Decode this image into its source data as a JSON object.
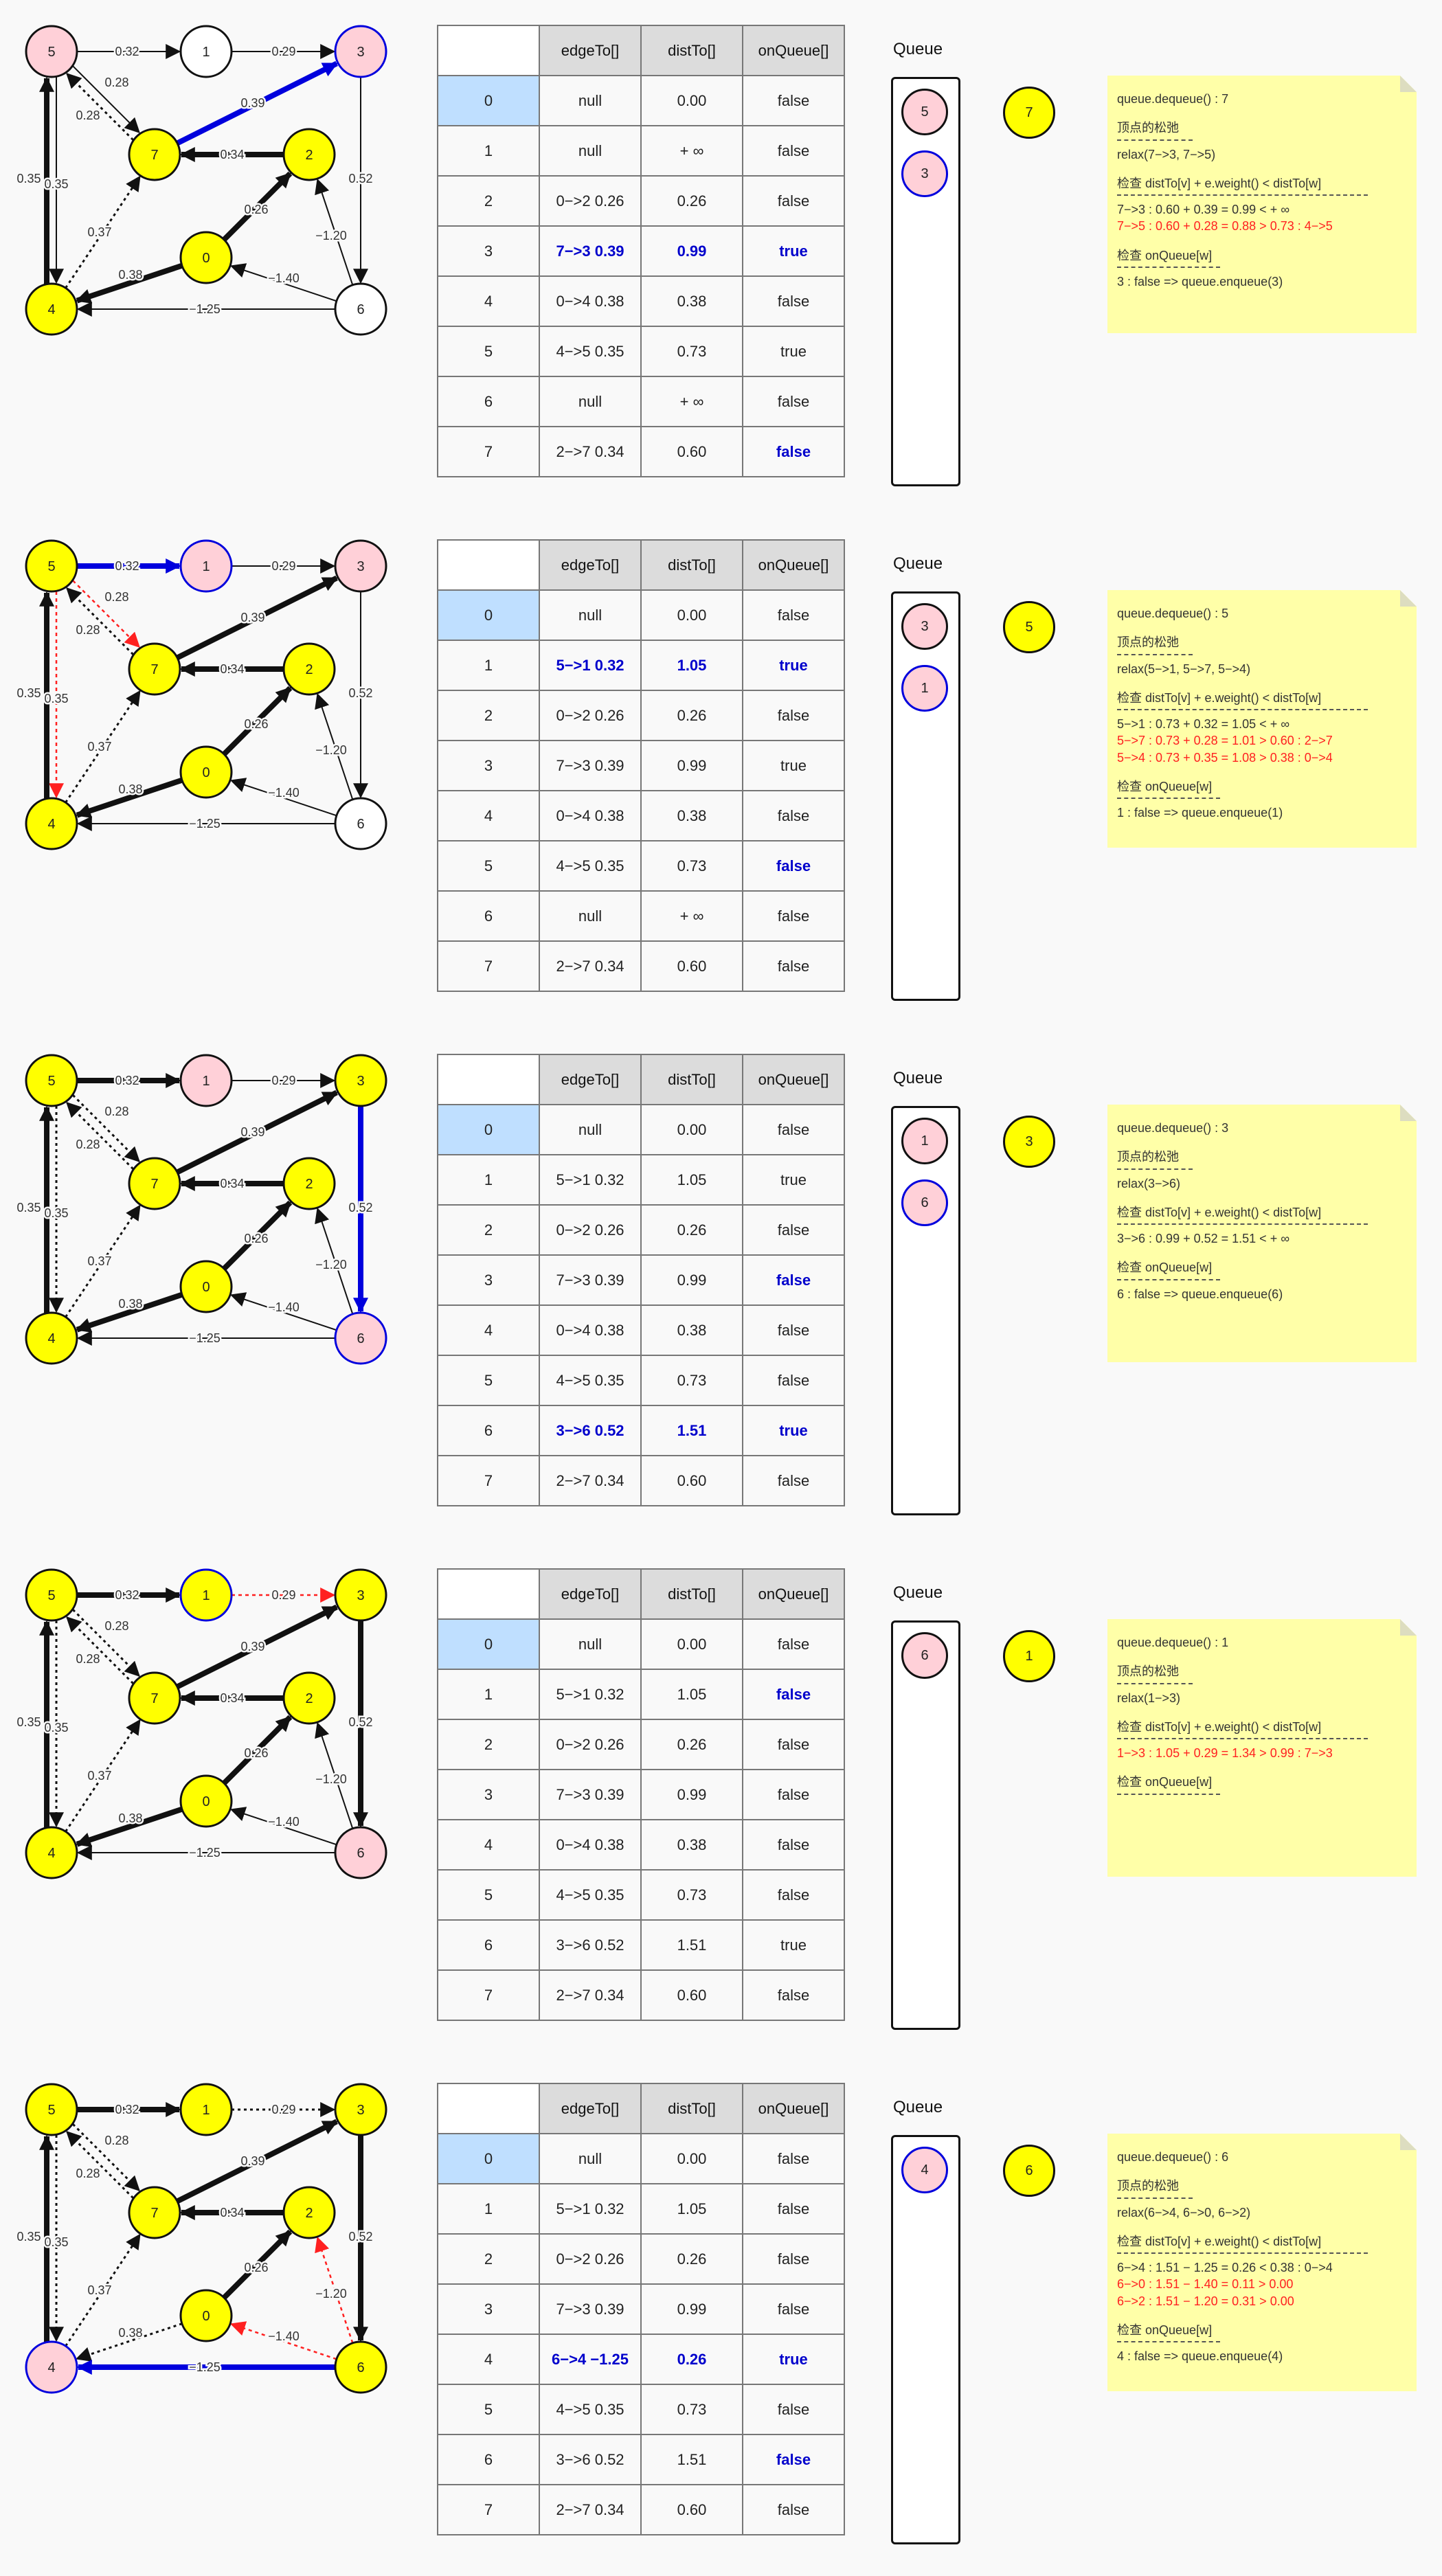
{
  "columns": [
    "edgeTo[]",
    "distTo[]",
    "onQueue[]"
  ],
  "queue_label": "Queue",
  "steps": [
    {
      "current": "7",
      "queue": [
        {
          "v": "5",
          "blue": false
        },
        {
          "v": "3",
          "blue": true
        }
      ],
      "rows": [
        {
          "v": "0",
          "edge": "null",
          "dist": "0.00",
          "onq": "false",
          "hl": []
        },
        {
          "v": "1",
          "edge": "null",
          "dist": "+ ∞",
          "onq": "false",
          "hl": []
        },
        {
          "v": "2",
          "edge": "0−>2 0.26",
          "dist": "0.26",
          "onq": "false",
          "hl": []
        },
        {
          "v": "3",
          "edge": "7−>3 0.39",
          "dist": "0.99",
          "onq": "true",
          "hl": [
            "edge",
            "dist",
            "onq"
          ]
        },
        {
          "v": "4",
          "edge": "0−>4 0.38",
          "dist": "0.38",
          "onq": "false",
          "hl": []
        },
        {
          "v": "5",
          "edge": "4−>5 0.35",
          "dist": "0.73",
          "onq": "true",
          "hl": []
        },
        {
          "v": "6",
          "edge": "null",
          "dist": "+ ∞",
          "onq": "false",
          "hl": []
        },
        {
          "v": "7",
          "edge": "2−>7 0.34",
          "dist": "0.60",
          "onq": "false",
          "hl": [
            "onq"
          ]
        }
      ],
      "nodes": {
        "0": "y",
        "1": "w",
        "2": "y",
        "3": "pb",
        "4": "y",
        "5": "p",
        "6": "w",
        "7": "y"
      },
      "edges": {
        "e53": "red",
        "e57": "thin",
        "e73": "blue"
      },
      "note": {
        "dequeue": "queue.dequeue() : 7",
        "relax_title": "顶点的松弛",
        "relax": "relax(7−>3, 7−>5)",
        "check_title": "检查 distTo[v] + e.weight() < distTo[w]",
        "check": [
          {
            "t": "7−>3 : 0.60 + 0.39 = 0.99 < + ∞",
            "red": false
          },
          {
            "t": "7−>5 : 0.60 + 0.28 = 0.88 > 0.73 : 4−>5",
            "red": true
          }
        ],
        "onq_title": "检查 onQueue[w]",
        "onq": "3 : false => queue.enqueue(3)"
      }
    },
    {
      "current": "5",
      "queue": [
        {
          "v": "3",
          "blue": false
        },
        {
          "v": "1",
          "blue": true
        }
      ],
      "rows": [
        {
          "v": "0",
          "edge": "null",
          "dist": "0.00",
          "onq": "false",
          "hl": []
        },
        {
          "v": "1",
          "edge": "5−>1 0.32",
          "dist": "1.05",
          "onq": "true",
          "hl": [
            "edge",
            "dist",
            "onq"
          ]
        },
        {
          "v": "2",
          "edge": "0−>2 0.26",
          "dist": "0.26",
          "onq": "false",
          "hl": []
        },
        {
          "v": "3",
          "edge": "7−>3 0.39",
          "dist": "0.99",
          "onq": "true",
          "hl": []
        },
        {
          "v": "4",
          "edge": "0−>4 0.38",
          "dist": "0.38",
          "onq": "false",
          "hl": []
        },
        {
          "v": "5",
          "edge": "4−>5 0.35",
          "dist": "0.73",
          "onq": "false",
          "hl": [
            "onq"
          ]
        },
        {
          "v": "6",
          "edge": "null",
          "dist": "+ ∞",
          "onq": "false",
          "hl": []
        },
        {
          "v": "7",
          "edge": "2−>7 0.34",
          "dist": "0.60",
          "onq": "false",
          "hl": []
        }
      ],
      "nodes": {
        "0": "y",
        "1": "pb",
        "2": "y",
        "3": "p",
        "4": "y",
        "5": "y",
        "6": "w",
        "7": "y"
      },
      "edges": {
        "e51": "blue",
        "e57": "red",
        "e54": "red",
        "e73": "bold"
      },
      "note": {
        "dequeue": "queue.dequeue() : 5",
        "relax_title": "顶点的松弛",
        "relax": "relax(5−>1, 5−>7, 5−>4)",
        "check_title": "检查 distTo[v] + e.weight() < distTo[w]",
        "check": [
          {
            "t": "5−>1 : 0.73 + 0.32 = 1.05 < + ∞",
            "red": false
          },
          {
            "t": "5−>7 : 0.73 + 0.28 = 1.01 > 0.60 : 2−>7",
            "red": true
          },
          {
            "t": "5−>4 : 0.73 + 0.35 = 1.08 > 0.38 : 0−>4",
            "red": true
          }
        ],
        "onq_title": "检查 onQueue[w]",
        "onq": "1 : false => queue.enqueue(1)"
      }
    },
    {
      "current": "3",
      "queue": [
        {
          "v": "1",
          "blue": false
        },
        {
          "v": "6",
          "blue": true
        }
      ],
      "rows": [
        {
          "v": "0",
          "edge": "null",
          "dist": "0.00",
          "onq": "false",
          "hl": []
        },
        {
          "v": "1",
          "edge": "5−>1 0.32",
          "dist": "1.05",
          "onq": "true",
          "hl": []
        },
        {
          "v": "2",
          "edge": "0−>2 0.26",
          "dist": "0.26",
          "onq": "false",
          "hl": []
        },
        {
          "v": "3",
          "edge": "7−>3 0.39",
          "dist": "0.99",
          "onq": "false",
          "hl": [
            "onq"
          ]
        },
        {
          "v": "4",
          "edge": "0−>4 0.38",
          "dist": "0.38",
          "onq": "false",
          "hl": []
        },
        {
          "v": "5",
          "edge": "4−>5 0.35",
          "dist": "0.73",
          "onq": "false",
          "hl": []
        },
        {
          "v": "6",
          "edge": "3−>6 0.52",
          "dist": "1.51",
          "onq": "true",
          "hl": [
            "edge",
            "dist",
            "onq"
          ]
        },
        {
          "v": "7",
          "edge": "2−>7 0.34",
          "dist": "0.60",
          "onq": "false",
          "hl": []
        }
      ],
      "nodes": {
        "0": "y",
        "1": "p",
        "2": "y",
        "3": "y",
        "4": "y",
        "5": "y",
        "6": "pb",
        "7": "y"
      },
      "edges": {
        "e51": "bold",
        "e57": "dot",
        "e54": "dot",
        "e73": "bold",
        "e36": "blue"
      },
      "note": {
        "dequeue": "queue.dequeue() : 3",
        "relax_title": "顶点的松弛",
        "relax": "relax(3−>6)",
        "check_title": "检查 distTo[v] + e.weight() < distTo[w]",
        "check": [
          {
            "t": "3−>6 : 0.99 + 0.52 = 1.51 < + ∞",
            "red": false
          }
        ],
        "onq_title": "检查 onQueue[w]",
        "onq": "6 : false => queue.enqueue(6)"
      }
    },
    {
      "current": "1",
      "queue": [
        {
          "v": "6",
          "blue": false
        }
      ],
      "rows": [
        {
          "v": "0",
          "edge": "null",
          "dist": "0.00",
          "onq": "false",
          "hl": []
        },
        {
          "v": "1",
          "edge": "5−>1 0.32",
          "dist": "1.05",
          "onq": "false",
          "hl": [
            "onq"
          ]
        },
        {
          "v": "2",
          "edge": "0−>2 0.26",
          "dist": "0.26",
          "onq": "false",
          "hl": []
        },
        {
          "v": "3",
          "edge": "7−>3 0.39",
          "dist": "0.99",
          "onq": "false",
          "hl": []
        },
        {
          "v": "4",
          "edge": "0−>4 0.38",
          "dist": "0.38",
          "onq": "false",
          "hl": []
        },
        {
          "v": "5",
          "edge": "4−>5 0.35",
          "dist": "0.73",
          "onq": "false",
          "hl": []
        },
        {
          "v": "6",
          "edge": "3−>6 0.52",
          "dist": "1.51",
          "onq": "true",
          "hl": []
        },
        {
          "v": "7",
          "edge": "2−>7 0.34",
          "dist": "0.60",
          "onq": "false",
          "hl": []
        }
      ],
      "nodes": {
        "0": "y",
        "1": "yb",
        "2": "y",
        "3": "y",
        "4": "y",
        "5": "y",
        "6": "p",
        "7": "y"
      },
      "edges": {
        "e51": "bold",
        "e57": "dot",
        "e54": "dot",
        "e73": "bold",
        "e36": "bold",
        "e13": "red"
      },
      "note": {
        "dequeue": "queue.dequeue() : 1",
        "relax_title": "顶点的松弛",
        "relax": "relax(1−>3)",
        "check_title": "检查 distTo[v] + e.weight() < distTo[w]",
        "check": [
          {
            "t": "1−>3 : 1.05 + 0.29 = 1.34 > 0.99 : 7−>3",
            "red": true
          }
        ],
        "onq_title": "检查 onQueue[w]",
        "onq": ""
      }
    },
    {
      "current": "6",
      "queue": [
        {
          "v": "4",
          "blue": true
        }
      ],
      "rows": [
        {
          "v": "0",
          "edge": "null",
          "dist": "0.00",
          "onq": "false",
          "hl": []
        },
        {
          "v": "1",
          "edge": "5−>1 0.32",
          "dist": "1.05",
          "onq": "false",
          "hl": []
        },
        {
          "v": "2",
          "edge": "0−>2 0.26",
          "dist": "0.26",
          "onq": "false",
          "hl": []
        },
        {
          "v": "3",
          "edge": "7−>3 0.39",
          "dist": "0.99",
          "onq": "false",
          "hl": []
        },
        {
          "v": "4",
          "edge": "6−>4 −1.25",
          "dist": "0.26",
          "onq": "true",
          "hl": [
            "edge",
            "dist",
            "onq"
          ]
        },
        {
          "v": "5",
          "edge": "4−>5 0.35",
          "dist": "0.73",
          "onq": "false",
          "hl": []
        },
        {
          "v": "6",
          "edge": "3−>6 0.52",
          "dist": "1.51",
          "onq": "false",
          "hl": [
            "onq"
          ]
        },
        {
          "v": "7",
          "edge": "2−>7 0.34",
          "dist": "0.60",
          "onq": "false",
          "hl": []
        }
      ],
      "nodes": {
        "0": "y",
        "1": "y",
        "2": "y",
        "3": "y",
        "4": "pb",
        "5": "y",
        "6": "y",
        "7": "y"
      },
      "edges": {
        "e51": "bold",
        "e57": "dot",
        "e54": "dot",
        "e73": "bold",
        "e36": "bold",
        "e13": "dot",
        "e04": "dot",
        "e64": "blue",
        "e60": "red",
        "e62": "red"
      },
      "note": {
        "dequeue": "queue.dequeue() : 6",
        "relax_title": "顶点的松弛",
        "relax": "relax(6−>4, 6−>0, 6−>2)",
        "check_title": "检查 distTo[v] + e.weight() < distTo[w]",
        "check": [
          {
            "t": "6−>4 : 1.51 − 1.25 = 0.26 < 0.38 : 0−>4",
            "red": false
          },
          {
            "t": "6−>0 : 1.51 − 1.40 = 0.11 > 0.00",
            "red": true
          },
          {
            "t": "6−>2 : 1.51 − 1.20 = 0.31 > 0.00",
            "red": true
          }
        ],
        "onq_title": "检查 onQueue[w]",
        "onq": "4 : false => queue.enqueue(4)"
      }
    }
  ],
  "graph": {
    "nodes": [
      "0",
      "1",
      "2",
      "3",
      "4",
      "5",
      "6",
      "7"
    ],
    "edges": [
      {
        "id": "e51",
        "from": "5",
        "to": "1",
        "label": "0.32",
        "def": "thin"
      },
      {
        "id": "e13",
        "from": "1",
        "to": "3",
        "label": "0.29",
        "def": "thin"
      },
      {
        "id": "e73",
        "from": "7",
        "to": "3",
        "label": "0.39",
        "def": "thin"
      },
      {
        "id": "e57",
        "from": "5",
        "to": "7",
        "label": "0.28",
        "def": "thin"
      },
      {
        "id": "e75",
        "from": "7",
        "to": "5",
        "label": "0.28",
        "def": "dot"
      },
      {
        "id": "e54",
        "from": "5",
        "to": "4",
        "label": "0.35",
        "def": "thin"
      },
      {
        "id": "e45",
        "from": "4",
        "to": "5",
        "label": "0.35",
        "def": "bold"
      },
      {
        "id": "e27",
        "from": "2",
        "to": "7",
        "label": "0.34",
        "def": "bold"
      },
      {
        "id": "e36",
        "from": "3",
        "to": "6",
        "label": "0.52",
        "def": "thin"
      },
      {
        "id": "e47",
        "from": "4",
        "to": "7",
        "label": "0.37",
        "def": "dot"
      },
      {
        "id": "e02",
        "from": "0",
        "to": "2",
        "label": "0.26",
        "def": "bold"
      },
      {
        "id": "e62",
        "from": "6",
        "to": "2",
        "label": "−1.20",
        "def": "thin"
      },
      {
        "id": "e04",
        "from": "0",
        "to": "4",
        "label": "0.38",
        "def": "bold"
      },
      {
        "id": "e60",
        "from": "6",
        "to": "0",
        "label": "−1.40",
        "def": "thin"
      },
      {
        "id": "e64",
        "from": "6",
        "to": "4",
        "label": "−1.25",
        "def": "thin"
      }
    ]
  },
  "colors": {
    "yellow": "#ffff00",
    "pink": "#ffd0d8",
    "white": "#ffffff",
    "blue": "#0000dd",
    "red": "#ff2020",
    "black": "#111111",
    "note": "#ffffa8",
    "highlight": "#bfdfff"
  }
}
